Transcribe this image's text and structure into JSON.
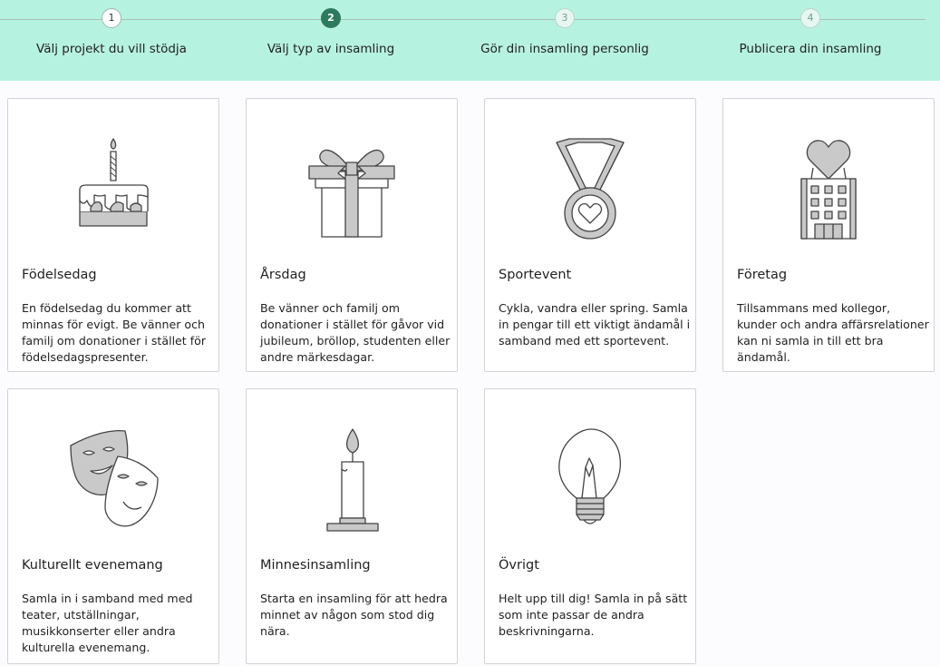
{
  "stepper": {
    "steps": [
      {
        "number": "1",
        "label": "Välj projekt du vill stödja",
        "state": "done"
      },
      {
        "number": "2",
        "label": "Välj typ av insamling",
        "state": "active"
      },
      {
        "number": "3",
        "label": "Gör din insamling personlig",
        "state": "future"
      },
      {
        "number": "4",
        "label": "Publicera din insamling",
        "state": "future"
      }
    ]
  },
  "cards": [
    {
      "icon": "birthday-cake-icon",
      "title": "Födelsedag",
      "description": "En födelsedag du kommer att minnas för evigt. Be vänner och familj om donationer i stället för födelsedagspresenter."
    },
    {
      "icon": "gift-icon",
      "title": "Årsdag",
      "description": "Be vänner och familj om donationer i stället för gåvor vid jubileum, bröllop, studenten eller andre märkesdagar."
    },
    {
      "icon": "medal-icon",
      "title": "Sportevent",
      "description": "Cykla, vandra eller spring. Samla in pengar till ett viktigt ändamål i samband med ett sportevent."
    },
    {
      "icon": "office-building-icon",
      "title": "Företag",
      "description": "Tillsammans med kollegor, kunder och andra affärsrelationer kan ni samla in till ett bra ändamål."
    },
    {
      "icon": "theater-masks-icon",
      "title": "Kulturellt evenemang",
      "description": "Samla in i samband med med teater, utställningar, musikkonserter eller andra kulturella evenemang."
    },
    {
      "icon": "candle-icon",
      "title": "Minnesinsamling",
      "description": "Starta en insamling för att hedra minnet av någon som stod dig nära."
    },
    {
      "icon": "lightbulb-icon",
      "title": "Övrigt",
      "description": "Helt upp till dig! Samla in på sätt som inte passar de andra beskrivningarna."
    }
  ],
  "colors": {
    "stepper_bg": "#b6f2e0",
    "active_step": "#2e7a5f",
    "icon_fill": "#c9c9c9",
    "icon_stroke": "#444444"
  }
}
